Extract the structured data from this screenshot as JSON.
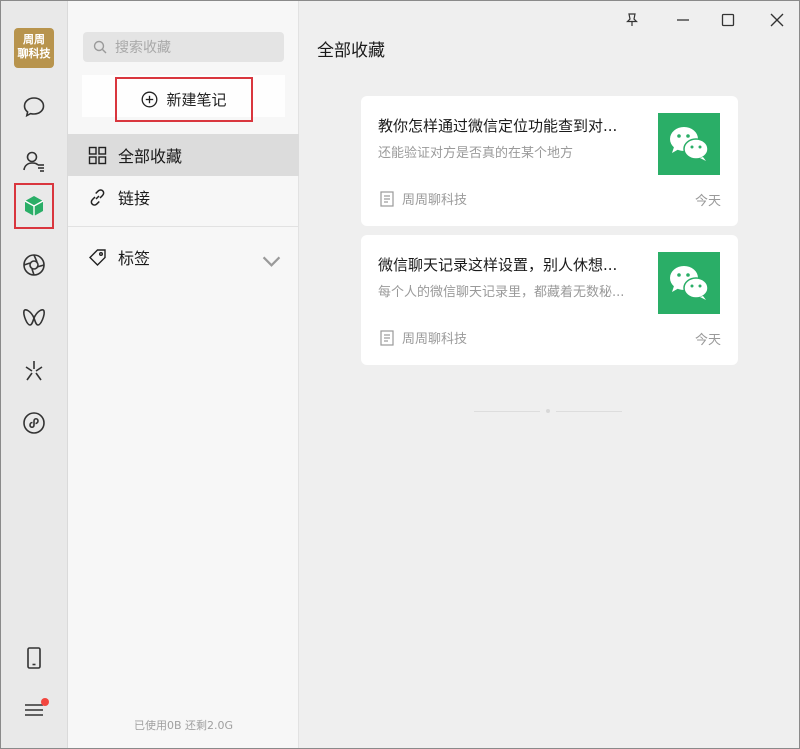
{
  "app": {
    "avatar_lines": [
      "周周",
      "聊科技"
    ]
  },
  "rail": {
    "icons": [
      "chat-icon",
      "contacts-icon",
      "favorites-icon",
      "moments-icon",
      "channels-icon",
      "discover-icon",
      "miniprogram-icon",
      "phone-icon",
      "menu-icon"
    ],
    "accent_color": "#2aae67",
    "highlight_color": "#d9363e"
  },
  "sidebar": {
    "search_placeholder": "搜索收藏",
    "new_note_label": "新建笔记",
    "items": [
      {
        "label": "全部收藏",
        "icon": "grid-icon"
      },
      {
        "label": "链接",
        "icon": "link-icon"
      },
      {
        "label": "标签",
        "icon": "tag-icon"
      }
    ],
    "storage_text": "已使用0B 还剩2.0G"
  },
  "main": {
    "title": "全部收藏",
    "cards": [
      {
        "title": "教你怎样通过微信定位功能查到对...",
        "description": "还能验证对方是否真的在某个地方",
        "source": "周周聊科技",
        "date": "今天",
        "thumbnail_icon": "wechat-logo-icon"
      },
      {
        "title": "微信聊天记录这样设置，别人休想...",
        "description": "每个人的微信聊天记录里，都藏着无数秘...",
        "source": "周周聊科技",
        "date": "今天",
        "thumbnail_icon": "wechat-logo-icon"
      }
    ]
  },
  "window_controls": [
    "pin-icon",
    "minimize-icon",
    "maximize-icon",
    "close-icon"
  ]
}
